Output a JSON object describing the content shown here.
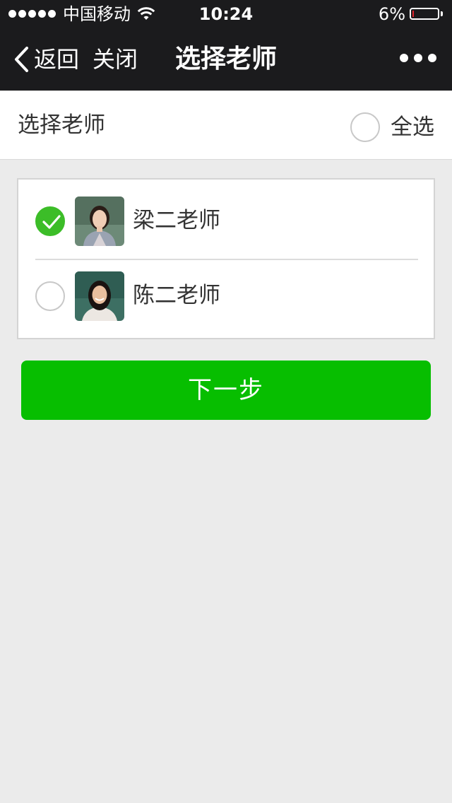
{
  "status_bar": {
    "carrier": "中国移动",
    "time": "10:24",
    "battery_percent": "6%",
    "battery_level": 0.06,
    "icons": [
      "signal-dots-icon",
      "wifi-icon",
      "battery-icon"
    ]
  },
  "nav": {
    "back_label": "返回",
    "close_label": "关闭",
    "title": "选择老师",
    "more_icon": "more-dots-icon"
  },
  "header": {
    "title": "选择老师",
    "select_all_label": "全选",
    "select_all_checked": false
  },
  "teachers": [
    {
      "name": "梁二老师",
      "checked": true
    },
    {
      "name": "陈二老师",
      "checked": false
    }
  ],
  "next_button_label": "下一步",
  "colors": {
    "nav_background": "#1b1b1d",
    "accent_green": "#07be00",
    "check_green": "#3cbd28",
    "page_background": "#ebebeb",
    "battery_low": "#e0242b"
  }
}
